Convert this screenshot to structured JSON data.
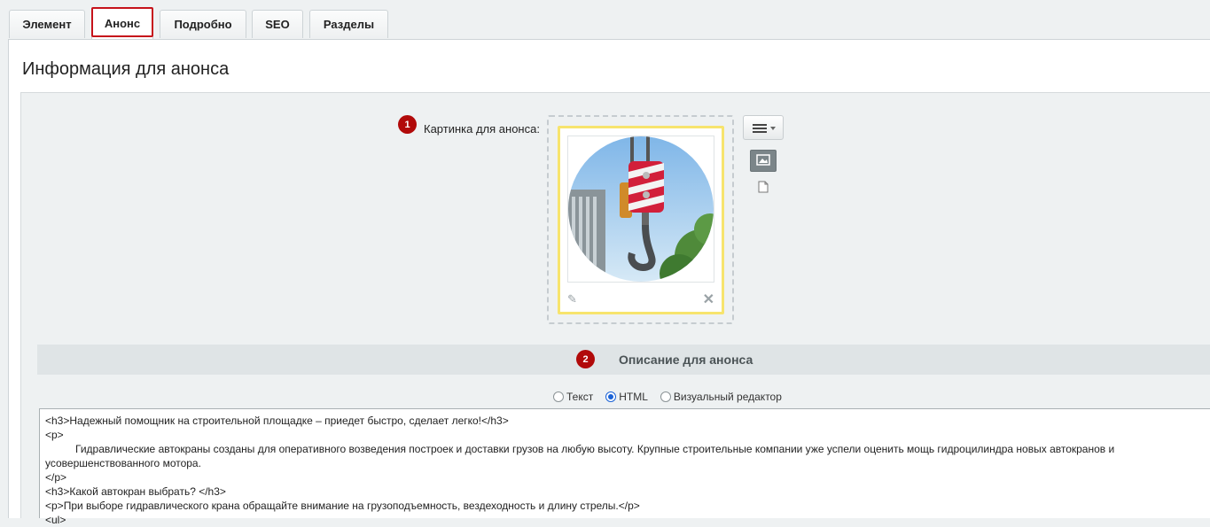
{
  "tabs": [
    {
      "label": "Элемент"
    },
    {
      "label": "Анонс",
      "active": true
    },
    {
      "label": "Подробно"
    },
    {
      "label": "SEO"
    },
    {
      "label": "Разделы"
    }
  ],
  "page_title": "Информация для анонса",
  "preview_picture": {
    "badge": "1",
    "label": "Картинка для анонса:",
    "image_icon": "crane-hook-image",
    "edit_icon": "pencil-icon",
    "delete_icon": "close-icon",
    "menu_icon": "hamburger-icon",
    "image_mode_icon": "image-icon",
    "file_mode_icon": "file-icon"
  },
  "preview_text": {
    "badge": "2",
    "title": "Описание для анонса",
    "modes": [
      {
        "label": "Текст",
        "selected": false
      },
      {
        "label": "HTML",
        "selected": true
      },
      {
        "label": "Визуальный редактор",
        "selected": false
      }
    ],
    "lines": [
      "<h3>Надежный помощник на строительной площадке – приедет быстро, сделает легко!</h3>",
      "<p>",
      "Гидравлические автокраны созданы для оперативного возведения построек и доставки грузов на любую высоту. Крупные строительные компании уже успели оценить мощь гидроцилиндра новых автокранов и",
      "усовершенствованного мотора.",
      "</p>",
      "<h3>Какой автокран выбрать? </h3>",
      "<p>При выборе гидравлического крана обращайте внимание на грузоподъемность, вездеходность и длину стрелы.</p>",
      "<ul>"
    ]
  },
  "colors": {
    "active_tab_outline": "#c6131b",
    "badge": "#b10a0a",
    "card_border": "#f7e46d",
    "radio_selected": "#1a62d6"
  }
}
